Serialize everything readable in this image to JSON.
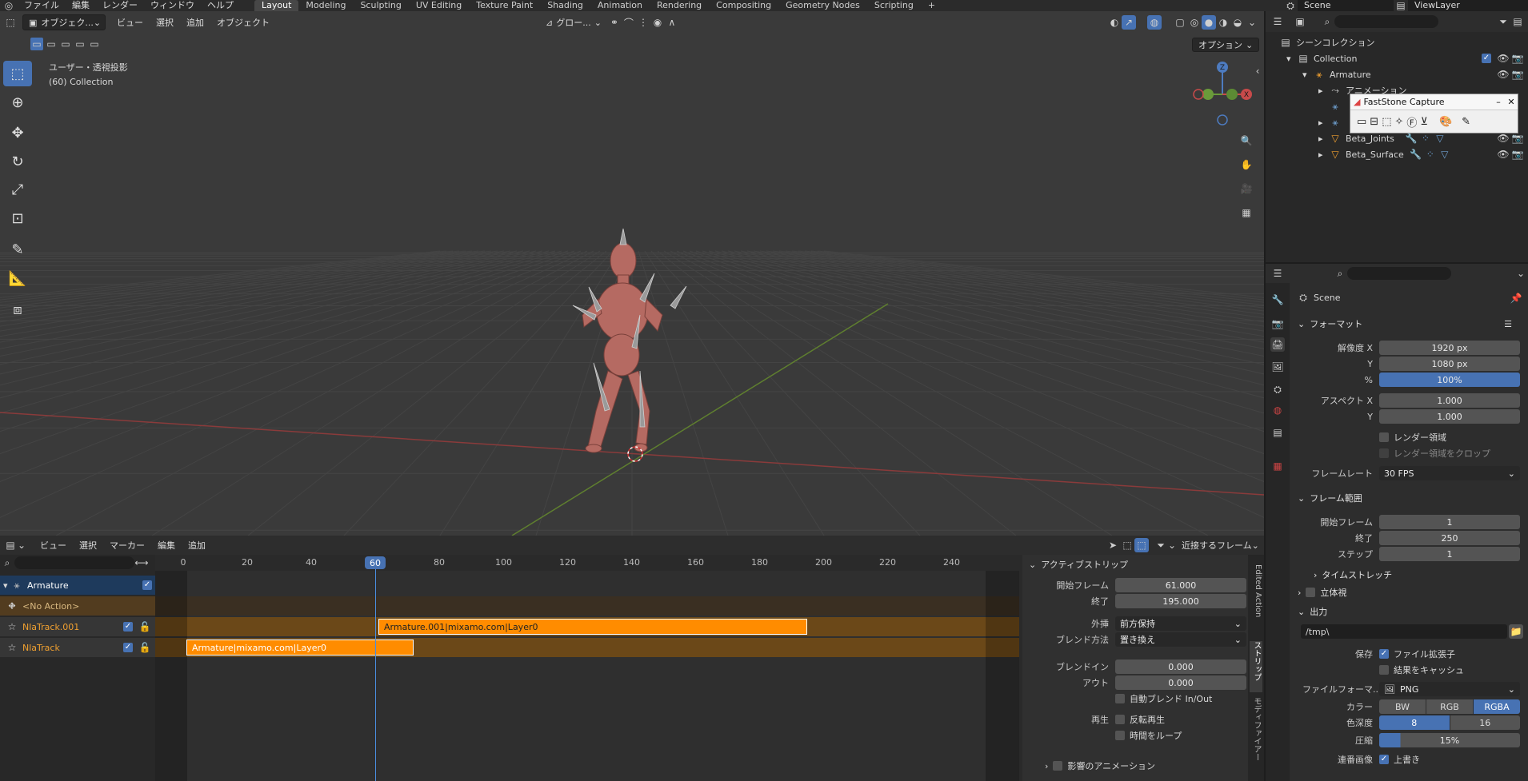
{
  "menubar": {
    "items": [
      "ファイル",
      "編集",
      "レンダー",
      "ウィンドウ",
      "ヘルプ"
    ],
    "workspaces": [
      "Layout",
      "Modeling",
      "Sculpting",
      "UV Editing",
      "Texture Paint",
      "Shading",
      "Animation",
      "Rendering",
      "Compositing",
      "Geometry Nodes",
      "Scripting"
    ],
    "active_workspace": "Layout",
    "scene_name": "Scene",
    "view_layer": "ViewLayer"
  },
  "viewport": {
    "mode": "オブジェク...",
    "menus": [
      "ビュー",
      "選択",
      "追加",
      "オブジェクト"
    ],
    "transform_orientation": "グロー...",
    "options_label": "オプション",
    "overlay_line1": "ユーザー・透視投影",
    "overlay_line2": "(60) Collection",
    "gizmo": {
      "z": "Z",
      "x": "X"
    }
  },
  "nla": {
    "menus": [
      "ビュー",
      "選択",
      "マーカー",
      "編集",
      "追加"
    ],
    "snap_label": "近接するフレーム",
    "ruler_ticks": [
      "0",
      "20",
      "40",
      "60",
      "80",
      "100",
      "120",
      "140",
      "160",
      "180",
      "200",
      "220",
      "240"
    ],
    "current_frame": "60",
    "channels": [
      {
        "name": "Armature",
        "type": "object"
      },
      {
        "name": "<No Action>",
        "type": "action"
      },
      {
        "name": "NlaTrack.001",
        "type": "track"
      },
      {
        "name": "NlaTrack",
        "type": "track"
      }
    ],
    "strips": [
      {
        "label": "Armature.001|mixamo.com|Layer0",
        "start": 61,
        "end": 195
      },
      {
        "label": "Armature|mixamo.com|Layer0",
        "start": 1,
        "end": 72
      }
    ],
    "sidebar": {
      "section_title": "アクティブストリップ",
      "start_label": "開始フレーム",
      "start_value": "61.000",
      "end_label": "終了",
      "end_value": "195.000",
      "extrapolation_label": "外挿",
      "extrapolation_value": "前方保持",
      "blend_label": "ブレンド方法",
      "blend_value": "置き換え",
      "blend_in_label": "ブレンドイン",
      "blend_in_value": "0.000",
      "blend_out_label": "アウト",
      "blend_out_value": "0.000",
      "auto_blend_label": "自動ブレンド In/Out",
      "playback_label": "再生",
      "reverse_label": "反転再生",
      "loop_label": "時間をループ",
      "influence_label": "影響のアニメーション",
      "tabs": [
        "Edited Action",
        "ストリップ",
        "モディファイアー"
      ]
    }
  },
  "outliner": {
    "rows": [
      {
        "label": "シーンコレクション",
        "indent": 0
      },
      {
        "label": "Collection",
        "indent": 1
      },
      {
        "label": "Armature",
        "indent": 2
      },
      {
        "label": "アニメーション",
        "indent": 3
      },
      {
        "label": "",
        "indent": 3
      },
      {
        "label": "",
        "indent": 3
      },
      {
        "label": "Beta_Joints",
        "indent": 3
      },
      {
        "label": "Beta_Surface",
        "indent": 3
      }
    ]
  },
  "faststone": {
    "title": "FastStone Capture"
  },
  "properties": {
    "scene_label": "Scene",
    "format_title": "フォーマット",
    "res_x_label": "解像度 X",
    "res_x": "1920 px",
    "res_y_label": "Y",
    "res_y": "1080 px",
    "res_pct_label": "%",
    "res_pct": "100%",
    "aspect_x_label": "アスペクト X",
    "aspect_x": "1.000",
    "aspect_y_label": "Y",
    "aspect_y": "1.000",
    "render_region": "レンダー領域",
    "crop_region": "レンダー領域をクロップ",
    "fps_label": "フレームレート",
    "fps": "30 FPS",
    "frame_range_title": "フレーム範囲",
    "frame_start_label": "開始フレーム",
    "frame_start": "1",
    "frame_end_label": "終了",
    "frame_end": "250",
    "frame_step_label": "ステップ",
    "frame_step": "1",
    "time_stretch": "タイムストレッチ",
    "stereo": "立体視",
    "output_title": "出力",
    "output_path": "/tmp\\",
    "save_label": "保存",
    "file_ext": "ファイル拡張子",
    "cache_result": "結果をキャッシュ",
    "file_format_label": "ファイルフォーマ...",
    "file_format": "PNG",
    "color_label": "カラー",
    "color_opts": [
      "BW",
      "RGB",
      "RGBA"
    ],
    "color_active": "RGBA",
    "depth_label": "色深度",
    "depth_opts": [
      "8",
      "16"
    ],
    "depth_active": "8",
    "compress_label": "圧縮",
    "compress": "15%",
    "sequence_label": "連番画像",
    "overwrite": "上書き"
  },
  "colors": {
    "accent": "#4772b3",
    "strip": "#ff8c00",
    "track_bg": "#6b4818"
  }
}
